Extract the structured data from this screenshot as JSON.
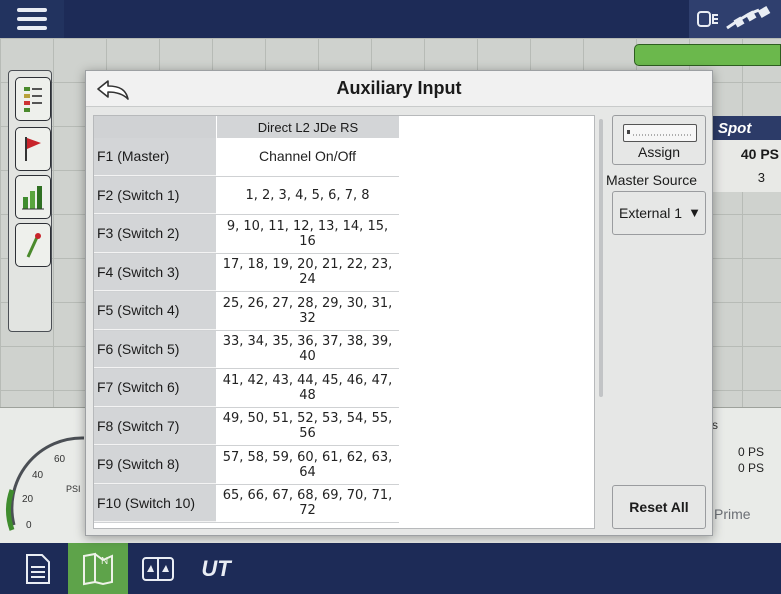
{
  "dialog": {
    "title": "Auxiliary Input",
    "column_header": "Direct L2 JDe RS",
    "rows": [
      {
        "label": "F1 (Master)",
        "value": "Channel On/Off"
      },
      {
        "label": "F2 (Switch 1)",
        "value": "1, 2, 3, 4, 5, 6, 7, 8"
      },
      {
        "label": "F3 (Switch 2)",
        "value": "9, 10, 11, 12, 13, 14, 15, 16"
      },
      {
        "label": "F4 (Switch 3)",
        "value": "17, 18, 19, 20, 21, 22, 23, 24"
      },
      {
        "label": "F5 (Switch 4)",
        "value": "25, 26, 27, 28, 29, 30, 31, 32"
      },
      {
        "label": "F6 (Switch 5)",
        "value": "33, 34, 35, 36, 37, 38, 39, 40"
      },
      {
        "label": "F7 (Switch 6)",
        "value": "41, 42, 43, 44, 45, 46, 47, 48"
      },
      {
        "label": "F8 (Switch 7)",
        "value": "49, 50, 51, 52, 53, 54, 55, 56"
      },
      {
        "label": "F9 (Switch 8)",
        "value": "57, 58, 59, 60, 61, 62, 63, 64"
      },
      {
        "label": "F10 (Switch 10)",
        "value": "65, 66, 67, 68, 69, 70, 71, 72"
      }
    ],
    "assign_label": "Assign",
    "master_source_label": "Master Source",
    "master_source_value": "External 1",
    "reset_label": "Reset All"
  },
  "background": {
    "spot_label": "Spot",
    "spot_psi": "40 PS",
    "spot_count": "3",
    "right_values": [
      "0 PS",
      "0 PS"
    ],
    "prime_label": "Prime",
    "gauge_unit": "PSI",
    "gauge_ticks": [
      "60",
      "40",
      "20",
      "0"
    ],
    "side_letter": "s"
  },
  "bottom_bar": {
    "ut_label": "UT"
  },
  "colors": {
    "bar_navy": "#1d2b57",
    "active_green": "#5ea34a",
    "field_green": "#6bb84c"
  }
}
